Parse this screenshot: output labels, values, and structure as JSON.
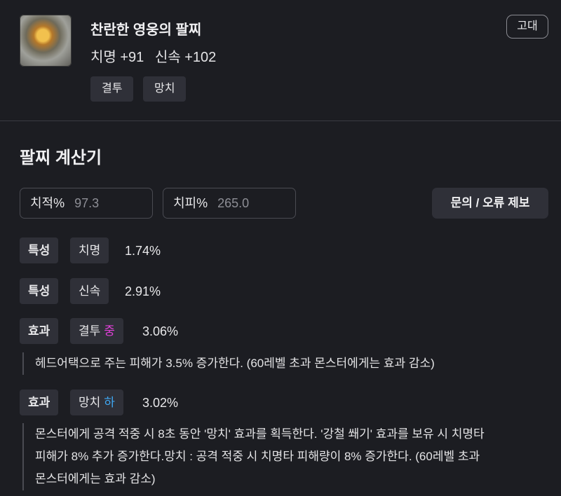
{
  "item": {
    "icon": "bracelet-icon",
    "name": "찬란한 영웅의 팔찌",
    "stats": [
      "치명 +91",
      "신속 +102"
    ],
    "engravings": [
      "결투",
      "망치"
    ],
    "grade": "고대"
  },
  "calculator": {
    "title": "팔찌 계산기",
    "crit_rate": {
      "label": "치적%",
      "value": "97.3"
    },
    "crit_damage": {
      "label": "치피%",
      "value": "265.0"
    },
    "report_button": "문의 / 오류 제보",
    "rows": [
      {
        "kind": "특성",
        "name": "치명",
        "level": "",
        "value": "1.74%"
      },
      {
        "kind": "특성",
        "name": "신속",
        "level": "",
        "value": "2.91%"
      },
      {
        "kind": "효과",
        "name": "결투",
        "level": "중",
        "value": "3.06%",
        "description": "헤드어택으로 주는 피해가 3.5% 증가한다. (60레벨 초과 몬스터에게는 효과 감소)"
      },
      {
        "kind": "효과",
        "name": "망치",
        "level": "하",
        "value": "3.02%",
        "description_lines": [
          "몬스터에게 공격 적중 시 8초 동안 '망치' 효과를 획득한다. '강철 쐐기' 효과를 보유 시 치명타",
          "피해가 8% 추가 증가한다.망치 : 공격 적중 시 치명타 피해량이 8% 증가한다. (60레벨 초과",
          "몬스터에게는 효과 감소)"
        ]
      }
    ]
  },
  "colors": {
    "background": "#1c1d22",
    "chip": "#2f3038",
    "level_mid": "#e040d8",
    "level_low": "#3fa9f5"
  }
}
